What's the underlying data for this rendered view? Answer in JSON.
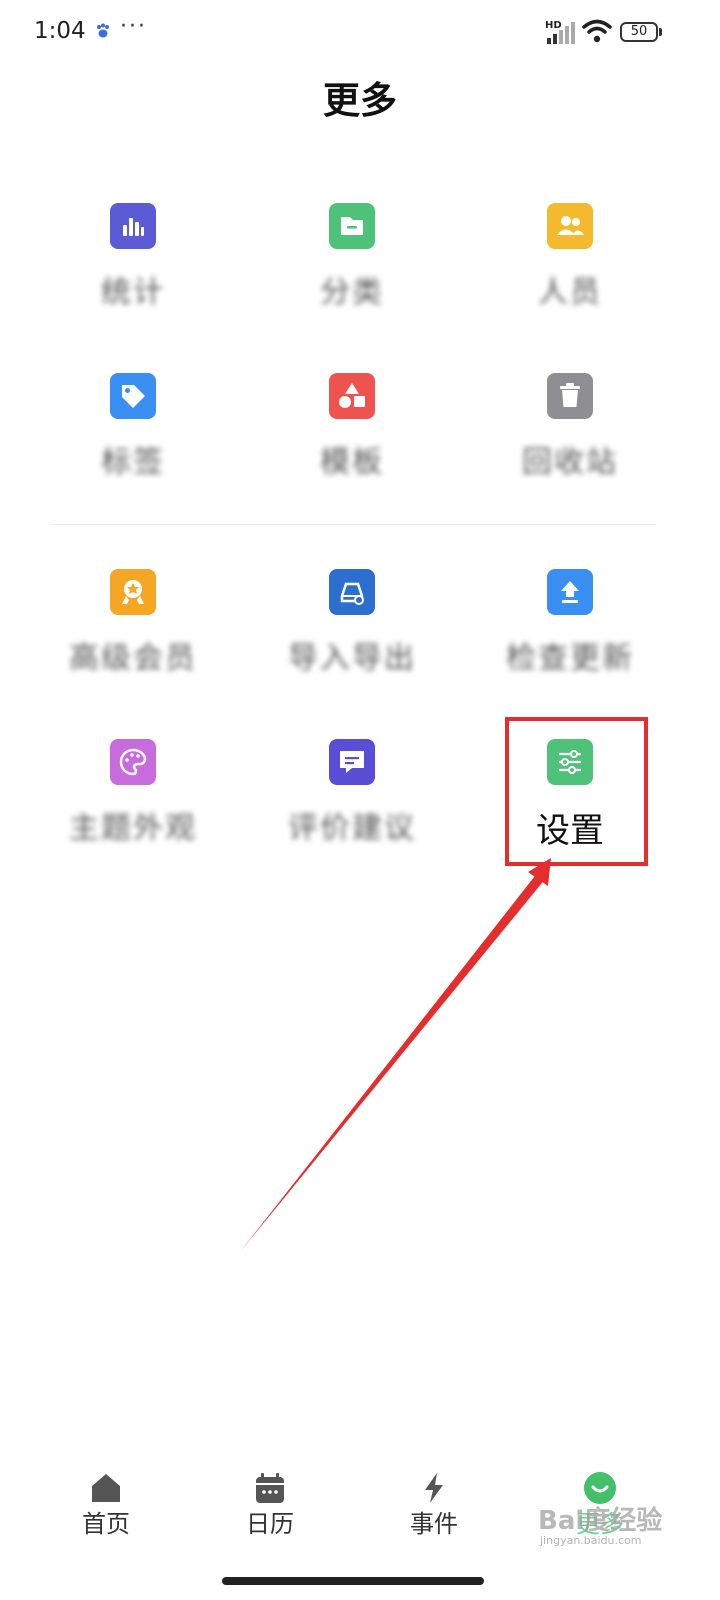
{
  "status_bar": {
    "time": "1:04",
    "more_dots": "···",
    "network_label": "HD",
    "battery": "50"
  },
  "header": {
    "title": "更多"
  },
  "grid": [
    {
      "label": "统计",
      "icon": "bar-chart-icon",
      "color": "#5b5bd6",
      "blurred": true
    },
    {
      "label": "分类",
      "icon": "folder-icon",
      "color": "#4fc27a",
      "blurred": true
    },
    {
      "label": "人员",
      "icon": "people-icon",
      "color": "#f5b92e",
      "blurred": true
    },
    {
      "label": "标签",
      "icon": "tag-icon",
      "color": "#3a8ff2",
      "blurred": true
    },
    {
      "label": "模板",
      "icon": "shapes-icon",
      "color": "#ef5350",
      "blurred": true
    },
    {
      "label": "回收站",
      "icon": "trash-icon",
      "color": "#8e8e93",
      "blurred": true
    },
    {
      "label": "高级会员",
      "icon": "badge-icon",
      "color": "#f5a623",
      "blurred": true
    },
    {
      "label": "导入导出",
      "icon": "import-export-icon",
      "color": "#2d6fd1",
      "blurred": true
    },
    {
      "label": "检查更新",
      "icon": "upload-icon",
      "color": "#3a8ff2",
      "blurred": true
    },
    {
      "label": "主题外观",
      "icon": "palette-icon",
      "color": "#c86bdc",
      "blurred": true
    },
    {
      "label": "评价建议",
      "icon": "message-icon",
      "color": "#5b4ed6",
      "blurred": true
    },
    {
      "label": "设置",
      "icon": "sliders-icon",
      "color": "#4fc27a",
      "blurred": false
    }
  ],
  "bottom_nav": [
    {
      "label": "首页",
      "icon": "home-icon",
      "active": false
    },
    {
      "label": "日历",
      "icon": "calendar-icon",
      "active": false
    },
    {
      "label": "事件",
      "icon": "lightning-icon",
      "active": false
    },
    {
      "label": "更多",
      "icon": "more-smile-icon",
      "active": true
    }
  ],
  "colors": {
    "accent": "#6fcf97",
    "annotation": "#e42d2d"
  },
  "watermark": {
    "text": "Bai度经验",
    "sub": "jingyan.baidu.com"
  }
}
